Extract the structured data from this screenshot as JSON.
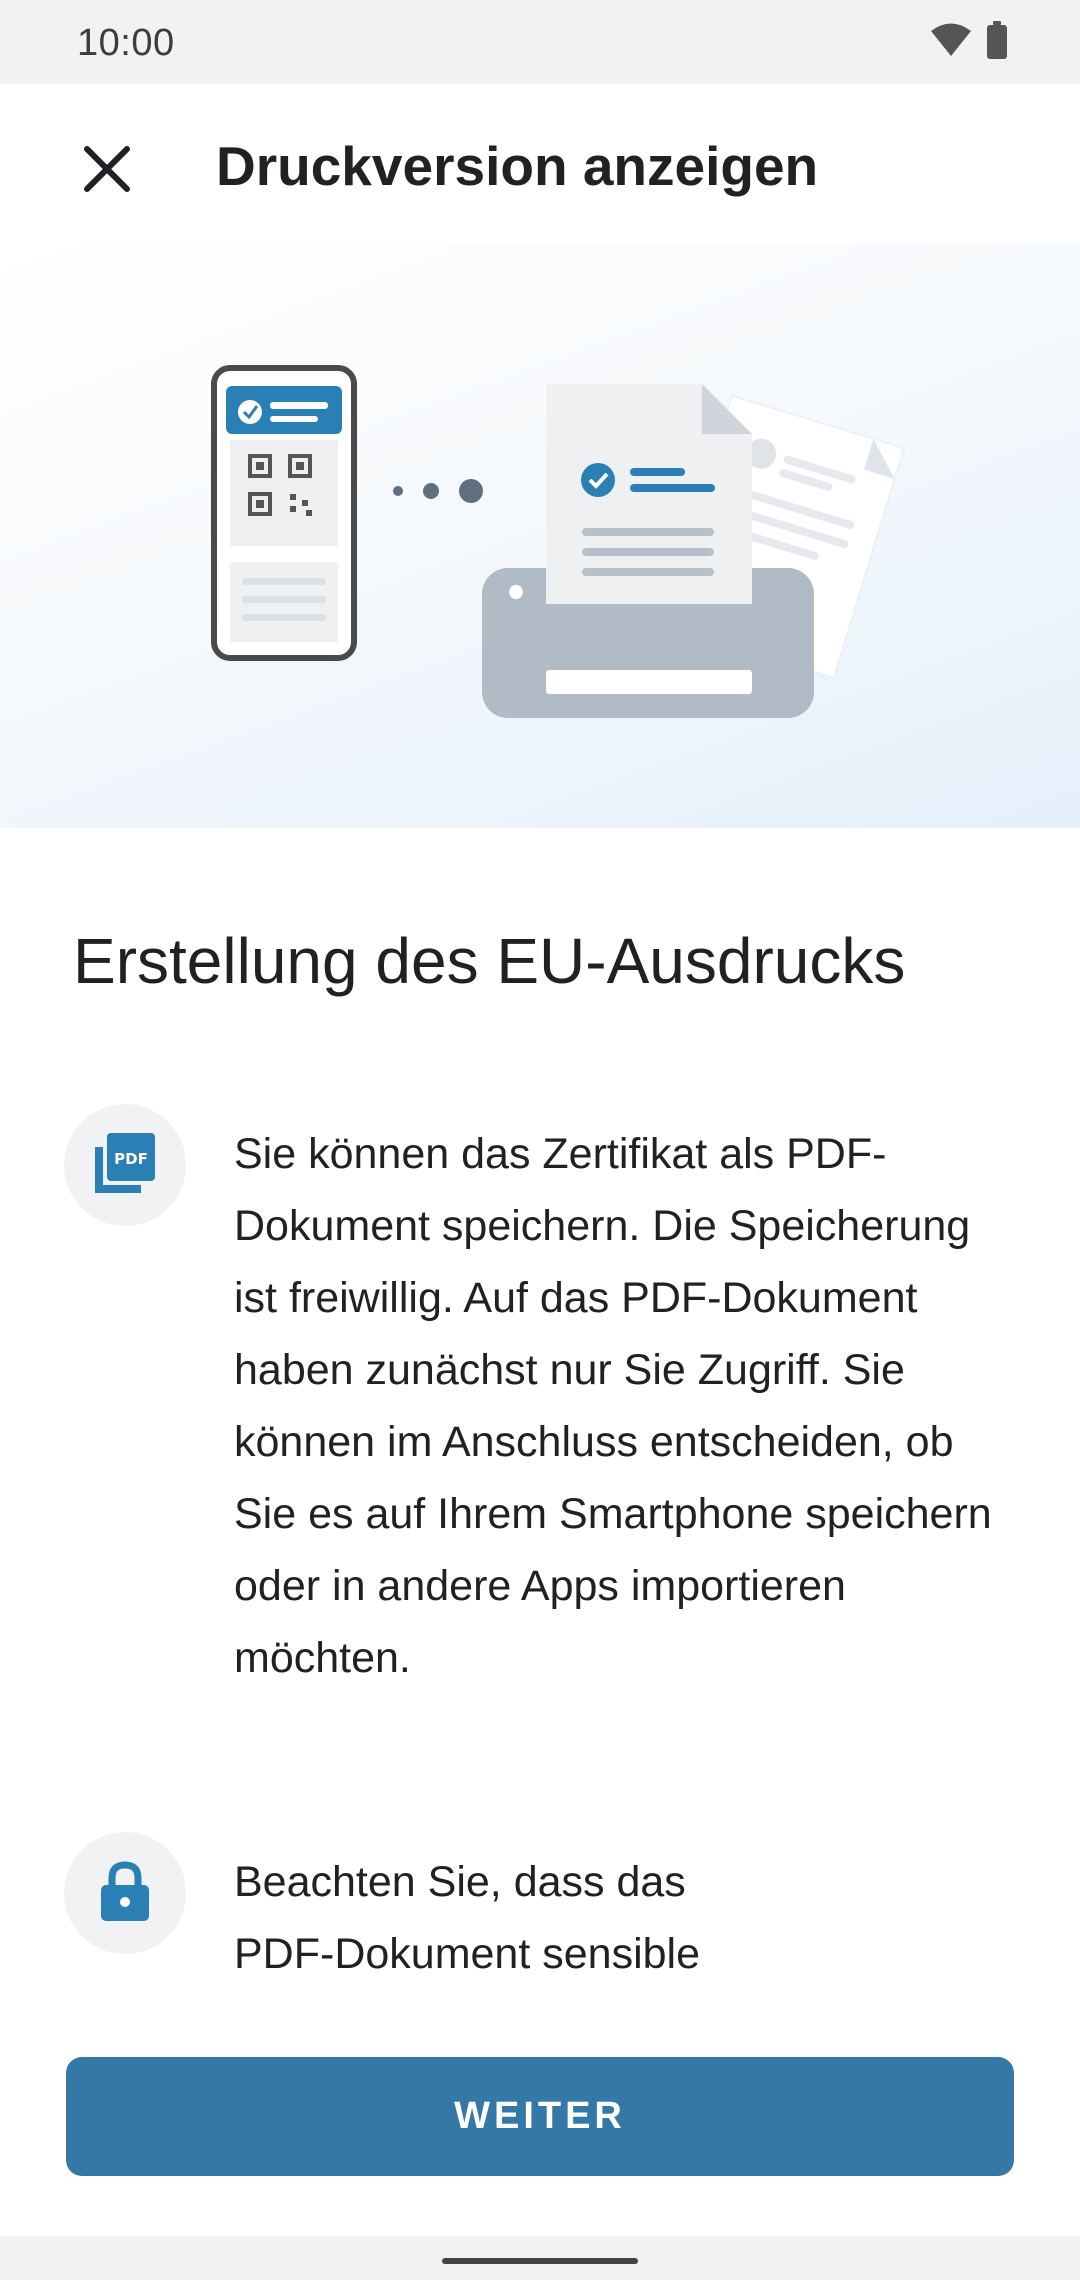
{
  "status_bar": {
    "time": "10:00",
    "icons": [
      "wifi-icon",
      "battery-icon"
    ]
  },
  "app_bar": {
    "close_icon": "close-icon",
    "title": "Druckversion anzeigen"
  },
  "hero": {
    "illustration": "phone-qr-to-printer-illustration",
    "colors": {
      "accent": "#2a7fb5",
      "printer": "#b0bbc6",
      "phone_outline": "#4a4a4a"
    }
  },
  "main": {
    "title": "Erstellung des EU-Ausdrucks",
    "items": [
      {
        "icon": "pdf-icon",
        "text": "Sie können das Zertifikat als PDF-Dokument speichern. Die Speicherung ist freiwillig. Auf das PDF-Dokument haben zunächst nur Sie Zugriff. Sie können im Anschluss entscheiden, ob Sie es auf Ihrem Smartphone speichern oder in andere Apps importieren möchten."
      },
      {
        "icon": "lock-icon",
        "text": "Beachten Sie, dass das PDF-Dokument sensible"
      }
    ]
  },
  "footer": {
    "button_label": "WEITER",
    "button_color": "#3478a8"
  }
}
